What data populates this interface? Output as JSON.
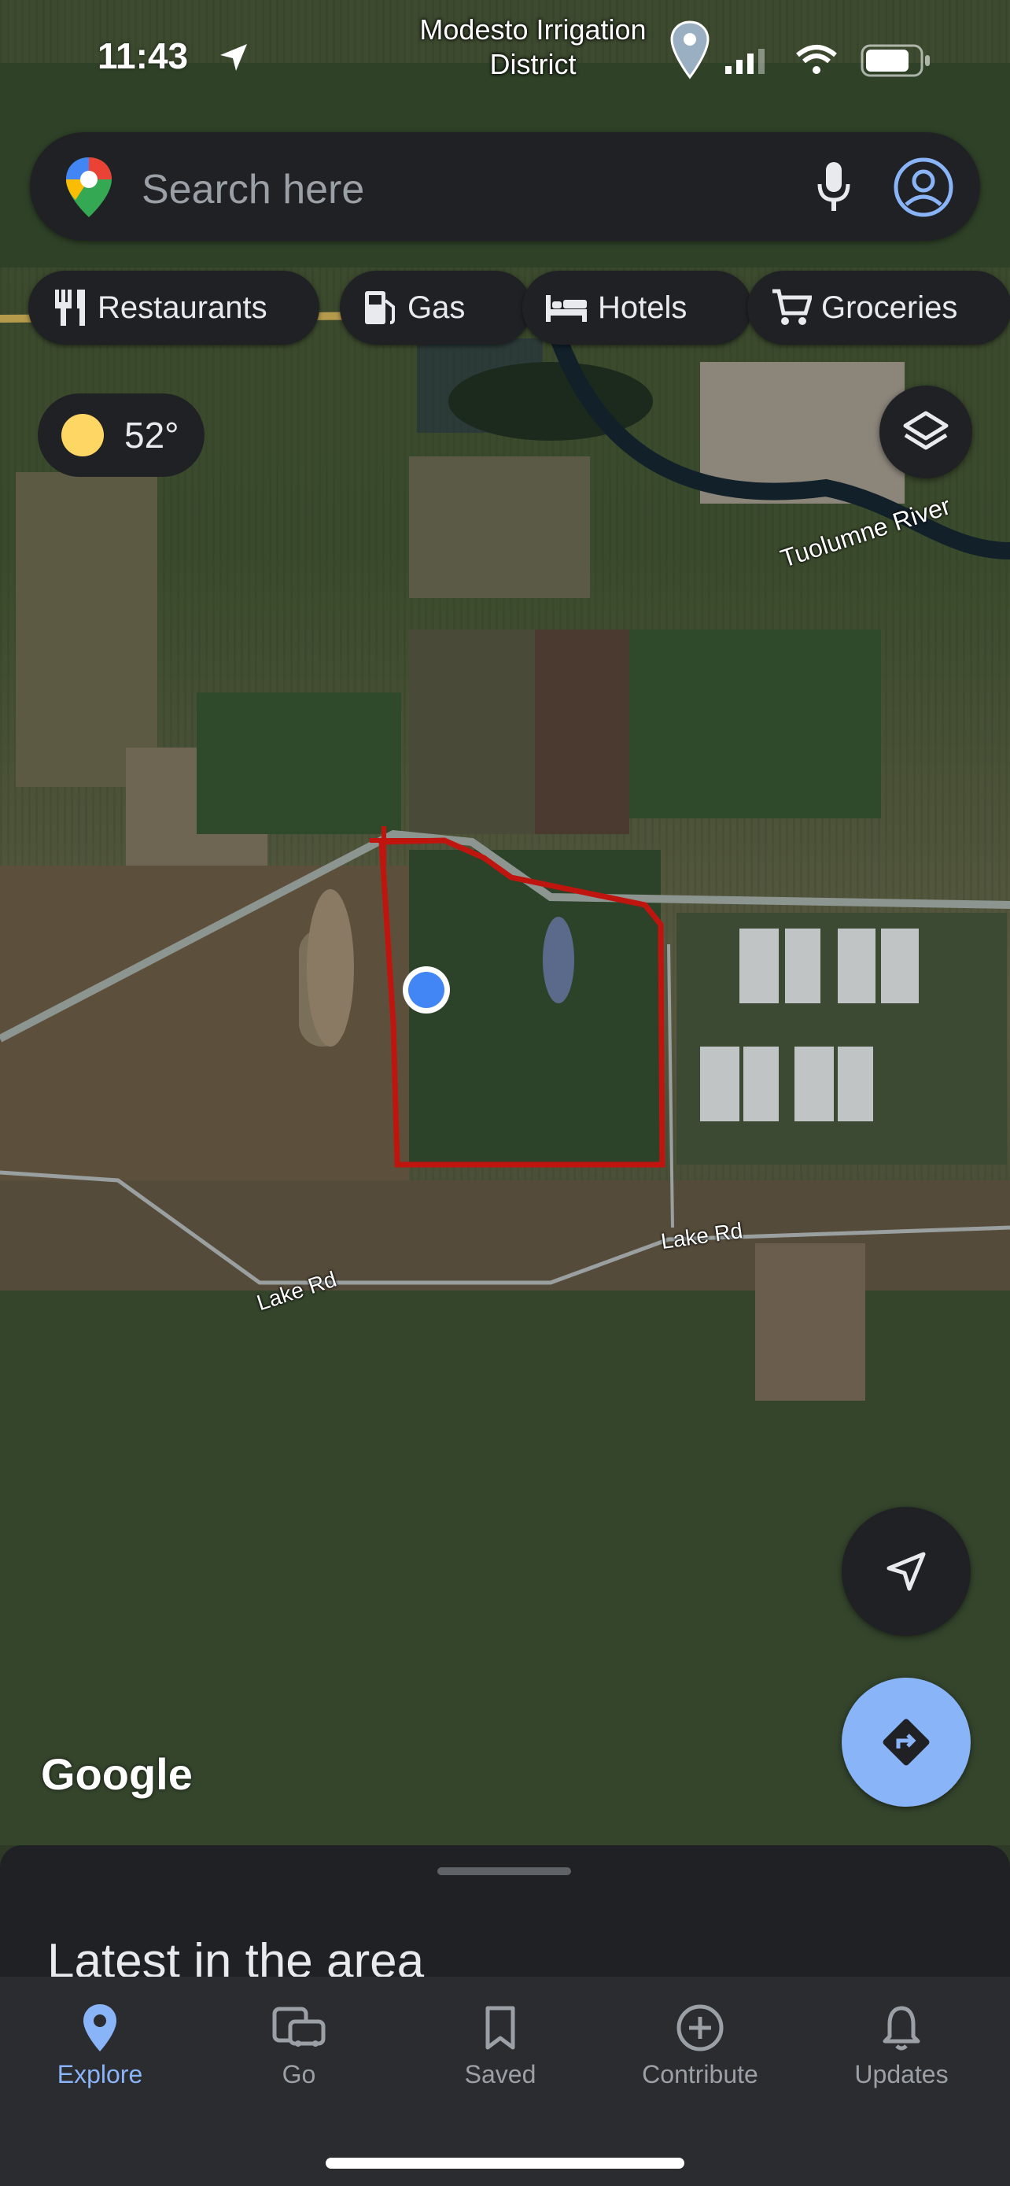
{
  "status_bar": {
    "time": "11:43"
  },
  "map": {
    "place_label": "Modesto Irrigation District",
    "river_label": "Tuolumne River",
    "road_label_1": "Lake Rd",
    "road_label_2": "Lake Rd",
    "google": "Google"
  },
  "search": {
    "placeholder": "Search here"
  },
  "chips": [
    {
      "label": "Restaurants",
      "icon": "fork-knife-icon"
    },
    {
      "label": "Gas",
      "icon": "gas-pump-icon"
    },
    {
      "label": "Hotels",
      "icon": "bed-icon"
    },
    {
      "label": "Groceries",
      "icon": "cart-icon"
    }
  ],
  "weather": {
    "temp": "52°"
  },
  "sheet": {
    "title": "Latest in the area"
  },
  "nav": [
    {
      "label": "Explore",
      "active": true
    },
    {
      "label": "Go"
    },
    {
      "label": "Saved"
    },
    {
      "label": "Contribute"
    },
    {
      "label": "Updates"
    }
  ],
  "colors": {
    "accent": "#8ab4f8",
    "boundary": "#c0150f",
    "location": "#4285f4"
  }
}
